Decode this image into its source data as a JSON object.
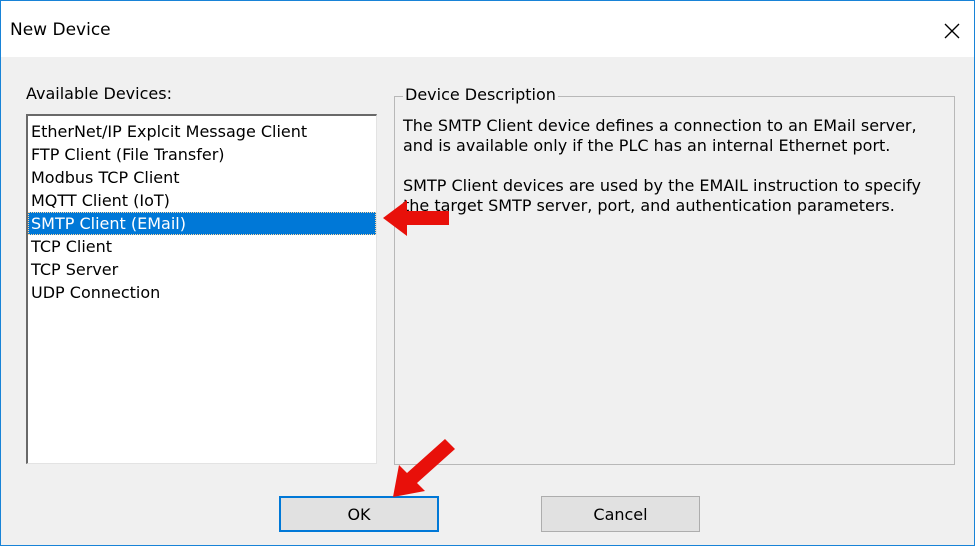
{
  "window": {
    "title": "New Device",
    "close_glyph": "✕"
  },
  "available": {
    "label": "Available Devices:",
    "items": [
      {
        "label": "EtherNet/IP Explcit Message Client",
        "selected": false
      },
      {
        "label": "FTP Client (File Transfer)",
        "selected": false
      },
      {
        "label": "Modbus TCP Client",
        "selected": false
      },
      {
        "label": "MQTT Client (IoT)",
        "selected": false
      },
      {
        "label": "SMTP Client (EMail)",
        "selected": true
      },
      {
        "label": "TCP Client",
        "selected": false
      },
      {
        "label": "TCP Server",
        "selected": false
      },
      {
        "label": "UDP Connection",
        "selected": false
      }
    ]
  },
  "description": {
    "label": "Device Description",
    "paragraph1": "The SMTP Client device defines a connection to an EMail server, and is available only if the PLC has an internal Ethernet port.",
    "paragraph2": "SMTP Client devices are used by the EMAIL instruction to specify the target SMTP server, port, and authentication parameters."
  },
  "buttons": {
    "ok_label": "OK",
    "cancel_label": "Cancel"
  },
  "colors": {
    "selection": "#0078d7",
    "annotation_arrow": "#e8100a",
    "window_border": "#1883d7"
  },
  "icons": {
    "close": "close-icon",
    "annotation": "red-arrow-icon"
  }
}
